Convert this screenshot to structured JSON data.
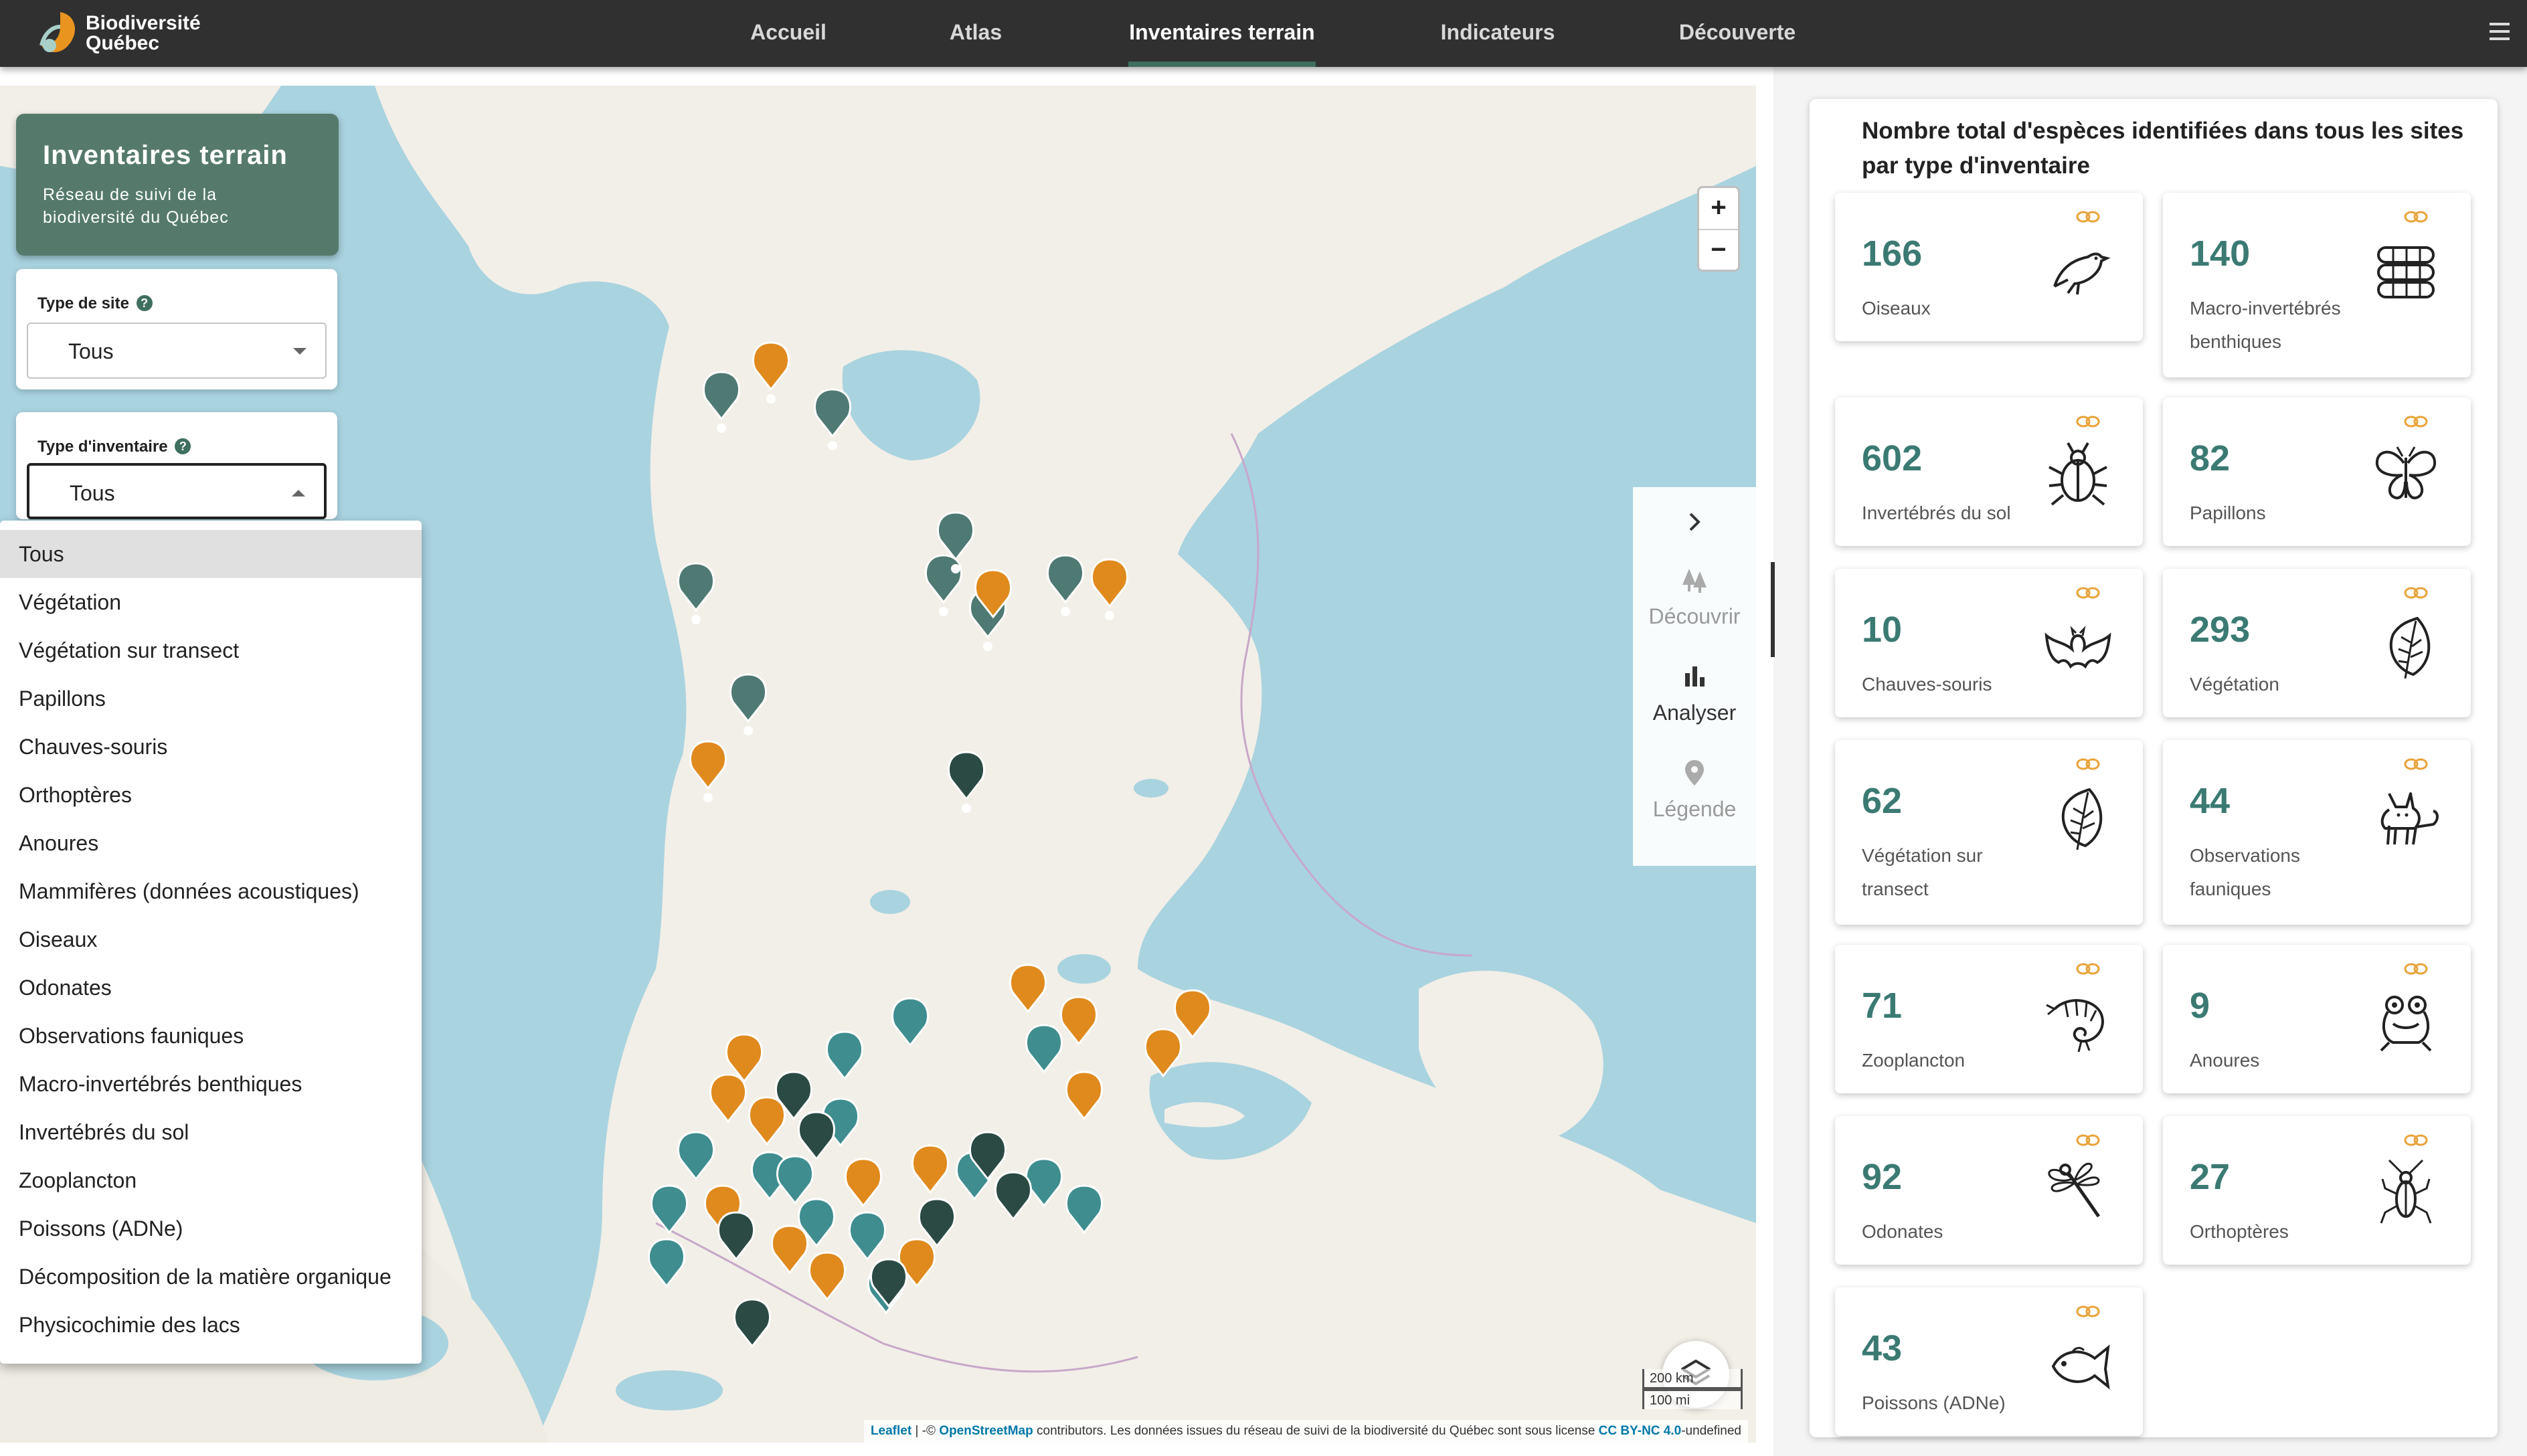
{
  "header": {
    "logo_text": "Biodiversité Québec",
    "nav": [
      {
        "label": "Accueil",
        "active": false
      },
      {
        "label": "Atlas",
        "active": false
      },
      {
        "label": "Inventaires terrain",
        "active": true
      },
      {
        "label": "Indicateurs",
        "active": false
      },
      {
        "label": "Découverte",
        "active": false
      }
    ]
  },
  "left_panel": {
    "title": "Inventaires terrain",
    "subtitle": "Réseau de suivi de la biodiversité du Québec",
    "site_type": {
      "label": "Type de site",
      "value": "Tous"
    },
    "inventory_type": {
      "label": "Type d'inventaire",
      "value": "Tous",
      "open": true
    },
    "dropdown_options": [
      "Tous",
      "Végétation",
      "Végétation sur transect",
      "Papillons",
      "Chauves-souris",
      "Orthoptères",
      "Anoures",
      "Mammifères (données acoustiques)",
      "Oiseaux",
      "Odonates",
      "Observations fauniques",
      "Macro-invertébrés benthiques",
      "Invertébrés du sol",
      "Zooplancton",
      "Poissons (ADNe)",
      "Décomposition de la matière organique",
      "Physicochimie des lacs"
    ],
    "selected_option": "Tous"
  },
  "map": {
    "zoom_in": "+",
    "zoom_out": "−",
    "tools": [
      {
        "label": "Découvrir",
        "icon": "trees-icon",
        "active": false
      },
      {
        "label": "Analyser",
        "icon": "bar-chart-icon",
        "active": true
      },
      {
        "label": "Légende",
        "icon": "location-pin-icon",
        "active": false
      }
    ],
    "scale": {
      "km": "200 km",
      "mi": "100 mi"
    },
    "attribution": {
      "leaflet": "Leaflet",
      "sep": " | -© ",
      "osm": "OpenStreetMap",
      "text": " contributors. Les données issues du réseau de suivi de la biodiversité du Québec sont sous license ",
      "license": "CC BY-NC 4.0",
      "tail": "-undefined"
    },
    "colors": {
      "vegetation_marker": "#4f7a73",
      "orange_marker": "#e08a1e",
      "fish_marker": "#3f8d8f",
      "dark_marker": "#2b4a44"
    }
  },
  "stats": {
    "title": "Nombre total d'espèces identifiées dans tous les sites par type d'inventaire",
    "accent_color": "#3b7a72",
    "cards": [
      {
        "value": "166",
        "label": "Oiseaux",
        "icon": "bird-icon"
      },
      {
        "value": "140",
        "label": "Macro-invertébrés benthiques",
        "icon": "worm-icon"
      },
      {
        "value": "602",
        "label": "Invertébrés du sol",
        "icon": "beetle-icon"
      },
      {
        "value": "82",
        "label": "Papillons",
        "icon": "butterfly-icon"
      },
      {
        "value": "10",
        "label": "Chauves-souris",
        "icon": "bat-icon"
      },
      {
        "value": "293",
        "label": "Végétation",
        "icon": "leaf-icon"
      },
      {
        "value": "62",
        "label": "Végétation sur transect",
        "icon": "leaf-icon"
      },
      {
        "value": "44",
        "label": "Observations fauniques",
        "icon": "fox-icon"
      },
      {
        "value": "71",
        "label": "Zooplancton",
        "icon": "shrimp-icon"
      },
      {
        "value": "9",
        "label": "Anoures",
        "icon": "frog-icon"
      },
      {
        "value": "92",
        "label": "Odonates",
        "icon": "dragonfly-icon"
      },
      {
        "value": "27",
        "label": "Orthoptères",
        "icon": "cricket-icon"
      },
      {
        "value": "43",
        "label": "Poissons (ADNe)",
        "icon": "fish-icon"
      }
    ]
  }
}
